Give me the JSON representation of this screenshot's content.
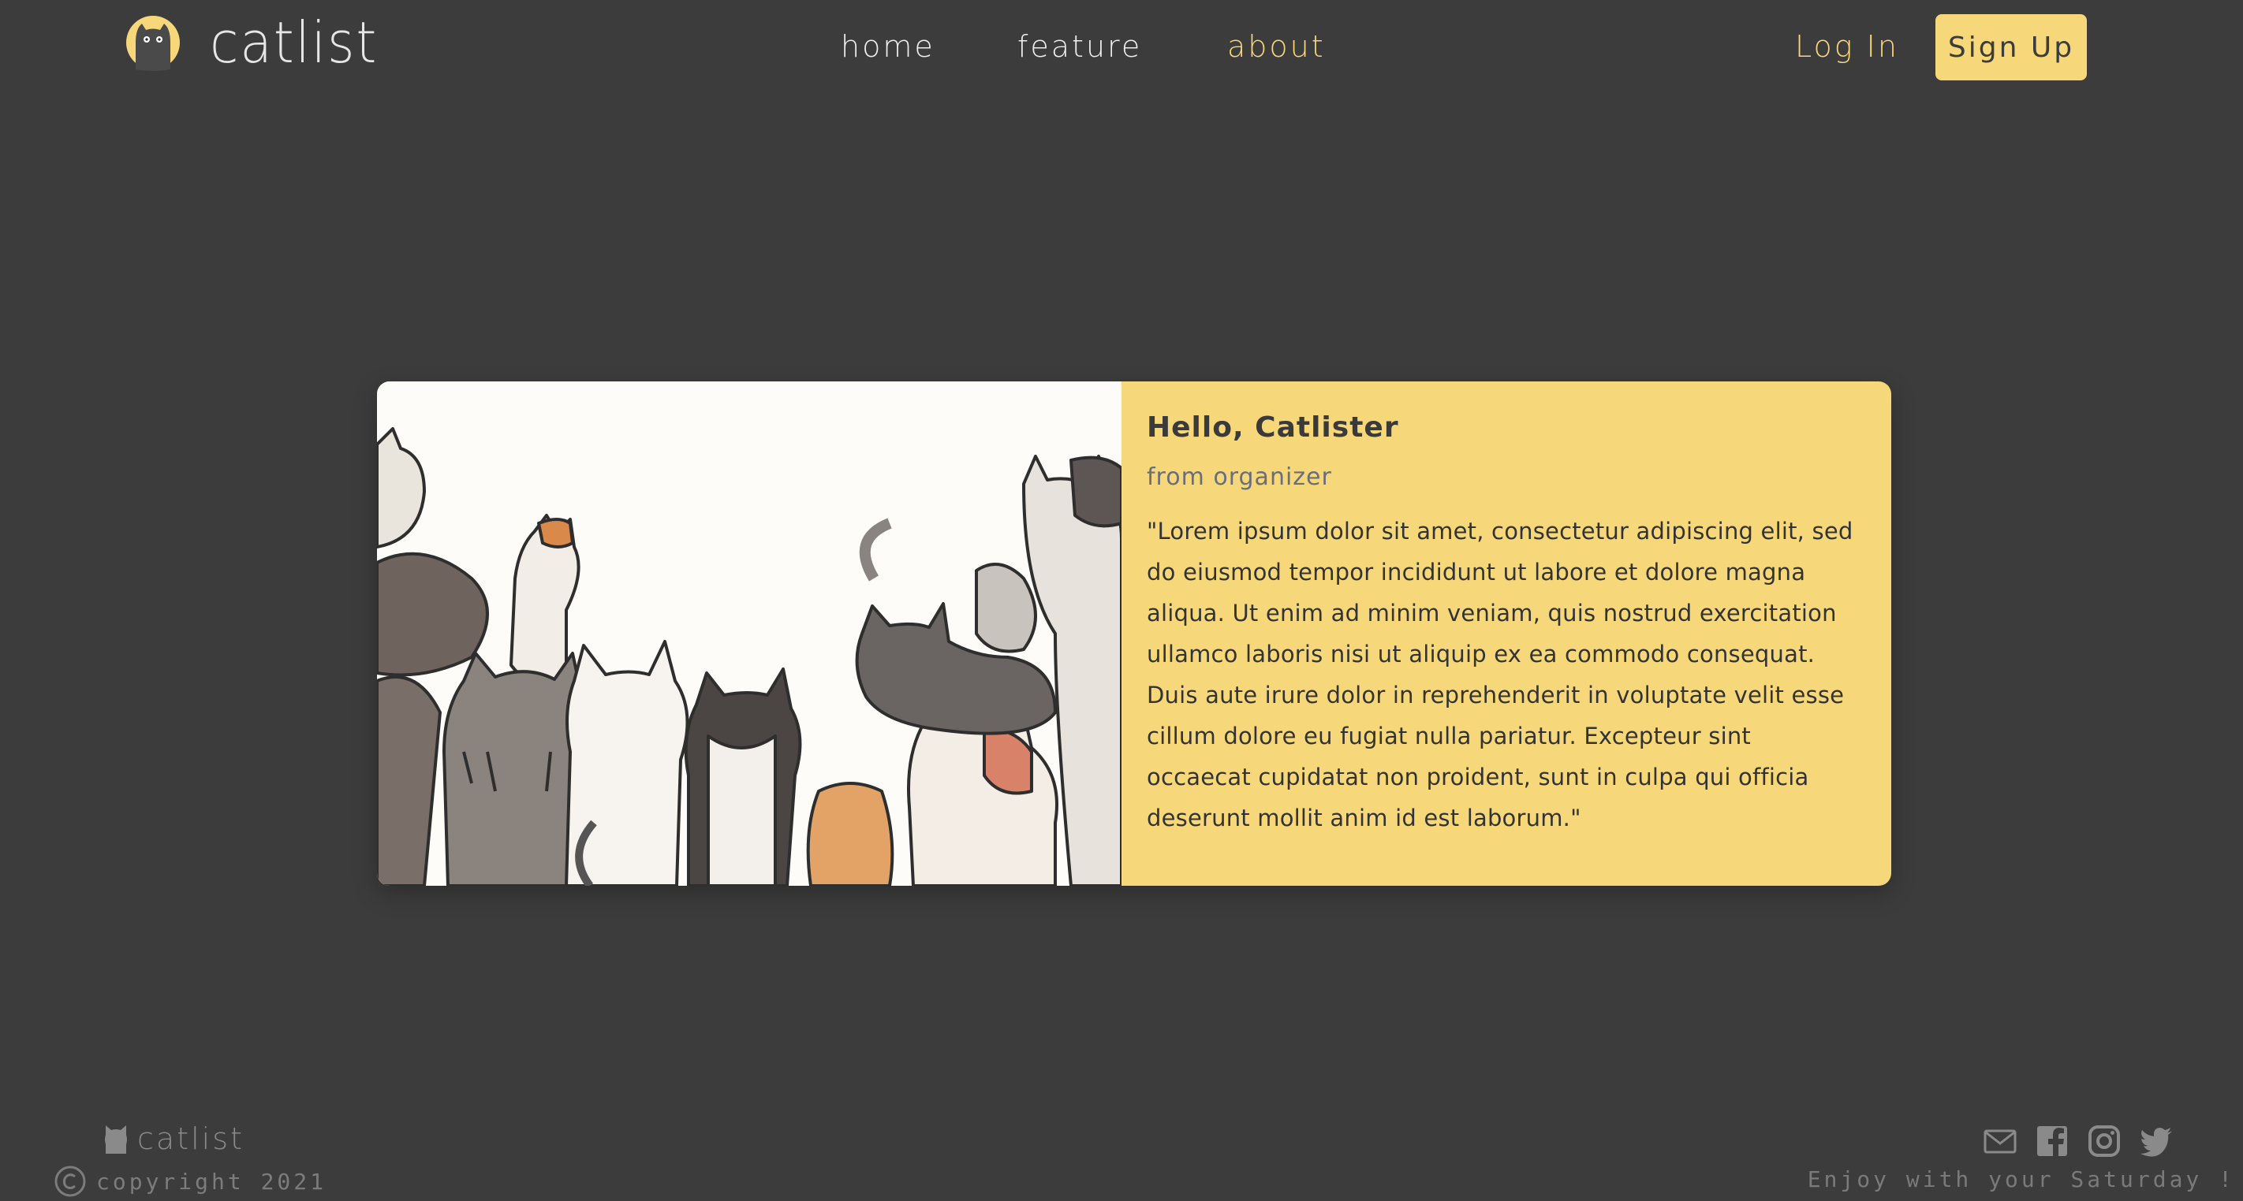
{
  "header": {
    "brand": "catlist",
    "nav": [
      {
        "label": "home"
      },
      {
        "label": "feature"
      },
      {
        "label": "about",
        "active": true
      }
    ],
    "login_label": "Log In",
    "signup_label": "Sign Up"
  },
  "card": {
    "title": "Hello, Catlister",
    "subtitle": "from organizer",
    "text": "\"Lorem ipsum dolor sit amet, consectetur adipiscing elit, sed do eiusmod tempor incididunt ut labore et dolore magna aliqua. Ut enim ad minim veniam, quis nostrud exercitation ullamco laboris nisi ut aliquip ex ea commodo consequat. Duis aute irure dolor in reprehenderit in voluptate velit esse cillum dolore eu fugiat nulla pariatur. Excepteur sint occaecat cupidatat non proident, sunt in culpa qui officia deserunt mollit anim id est laborum.\"",
    "image": "illustration-of-many-cartoon-cats"
  },
  "footer": {
    "brand": "catlist",
    "copyright": "copyright 2021",
    "tagline": "Enjoy with your Saturday !",
    "socials": [
      "mail-icon",
      "facebook-icon",
      "instagram-icon",
      "twitter-icon"
    ]
  },
  "colors": {
    "background": "#3c3c3c",
    "accent": "#f6d87a",
    "text_light": "#eeeeee",
    "muted": "#7a7a7a"
  }
}
